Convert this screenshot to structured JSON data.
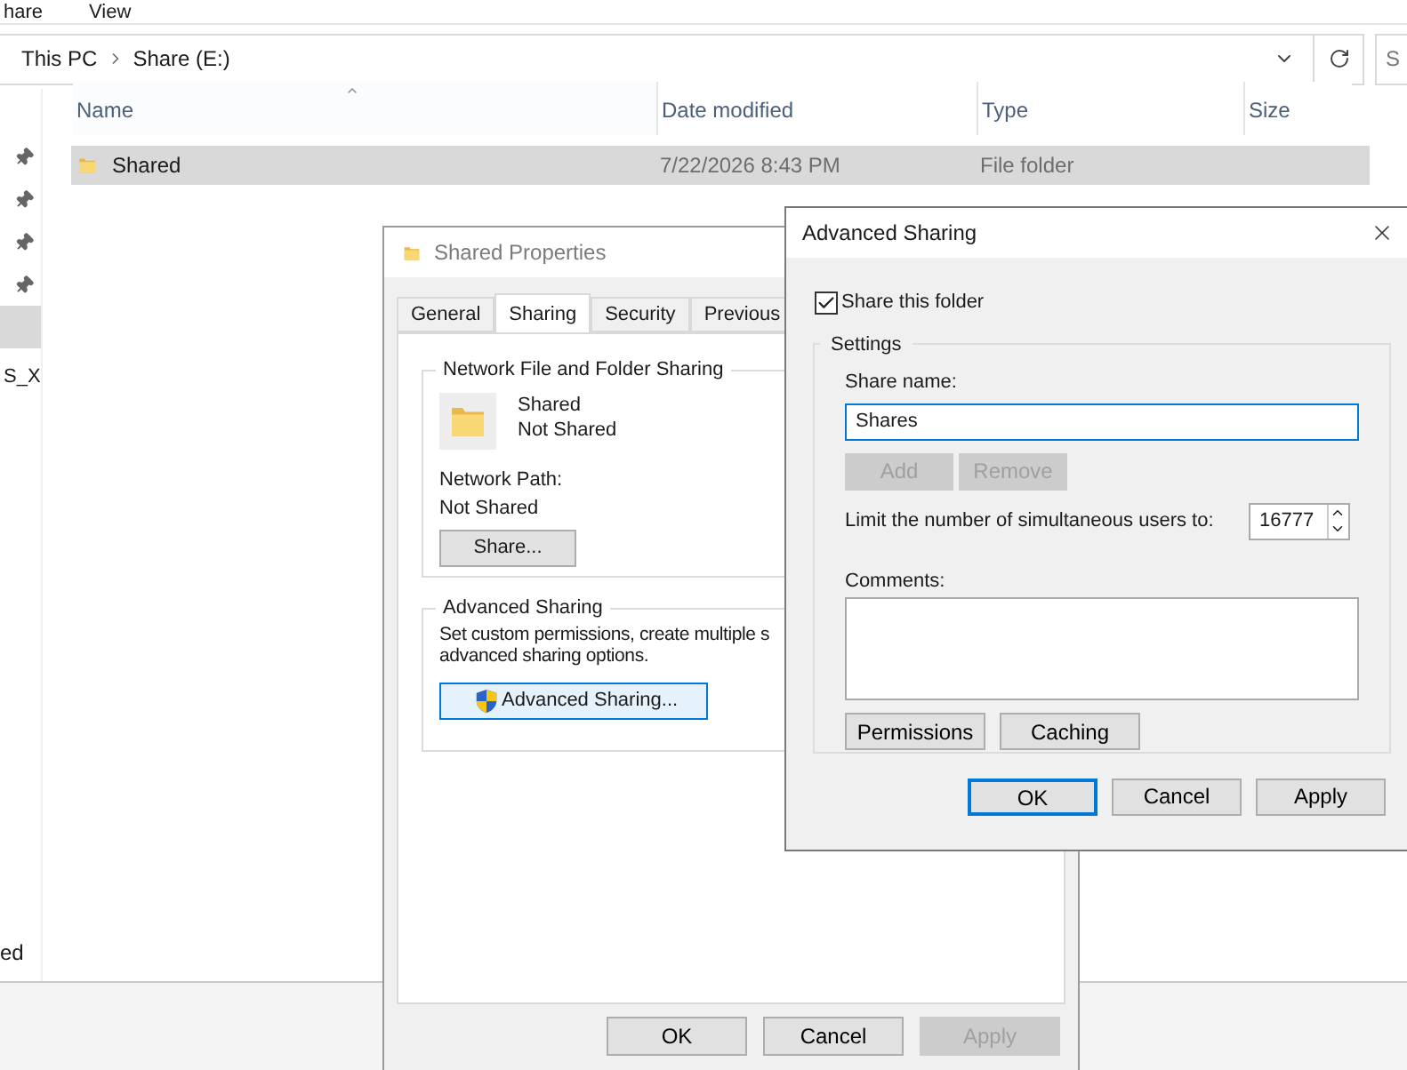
{
  "explorer": {
    "ribbon_tabs": [
      "hare",
      "View"
    ],
    "breadcrumbs": [
      "This PC",
      "Share (E:)"
    ],
    "search": {
      "placeholder": "S"
    },
    "quick_access": [
      {
        "pinned": true,
        "selected": false
      },
      {
        "pinned": true,
        "selected": false
      },
      {
        "pinned": true,
        "selected": false
      },
      {
        "pinned": true,
        "selected": false
      },
      {
        "pinned": false,
        "selected": true
      }
    ],
    "nav_labels": [
      "S_X",
      "ed"
    ],
    "columns": [
      {
        "label": "Name",
        "sorted": true
      },
      {
        "label": "Date modified",
        "sorted": false
      },
      {
        "label": "Type",
        "sorted": false
      },
      {
        "label": "Size",
        "sorted": false
      }
    ],
    "rows": [
      {
        "name": "Shared",
        "date_modified": "7/22/2026 8:43 PM",
        "type": "File folder",
        "selected": true
      }
    ]
  },
  "properties": {
    "title": "Shared Properties",
    "tabs": [
      {
        "label": "General",
        "selected": false
      },
      {
        "label": "Sharing",
        "selected": true
      },
      {
        "label": "Security",
        "selected": false
      },
      {
        "label": "Previous",
        "selected": false
      }
    ],
    "network_group": {
      "title": "Network File and Folder Sharing",
      "name": "Shared",
      "status": "Not Shared",
      "path_label": "Network Path:",
      "path": "Not Shared",
      "button": "Share..."
    },
    "advanced_group": {
      "title": "Advanced Sharing",
      "lines": [
        "Set custom permissions, create multiple s",
        "advanced sharing options."
      ],
      "button": "Advanced Sharing..."
    },
    "buttons": [
      {
        "label": "OK",
        "disabled": false
      },
      {
        "label": "Cancel",
        "disabled": false
      },
      {
        "label": "Apply",
        "disabled": true
      }
    ]
  },
  "advanced": {
    "title": "Advanced Sharing",
    "share_folder": {
      "label": "Share this folder",
      "checked": true
    },
    "settings_title": "Settings",
    "share_name_label": "Share name:",
    "share_name": "Shares",
    "name_buttons": [
      {
        "label": "Add",
        "disabled": true
      },
      {
        "label": "Remove",
        "disabled": true
      }
    ],
    "limit_label": "Limit the number of simultaneous users to:",
    "limit": "16777",
    "comments_label": "Comments:",
    "option_buttons": [
      {
        "label": "Permissions",
        "disabled": false
      },
      {
        "label": "Caching",
        "disabled": false
      }
    ],
    "buttons": [
      {
        "label": "OK",
        "default": true
      },
      {
        "label": "Cancel",
        "default": false
      },
      {
        "label": "Apply",
        "default": false
      }
    ]
  }
}
